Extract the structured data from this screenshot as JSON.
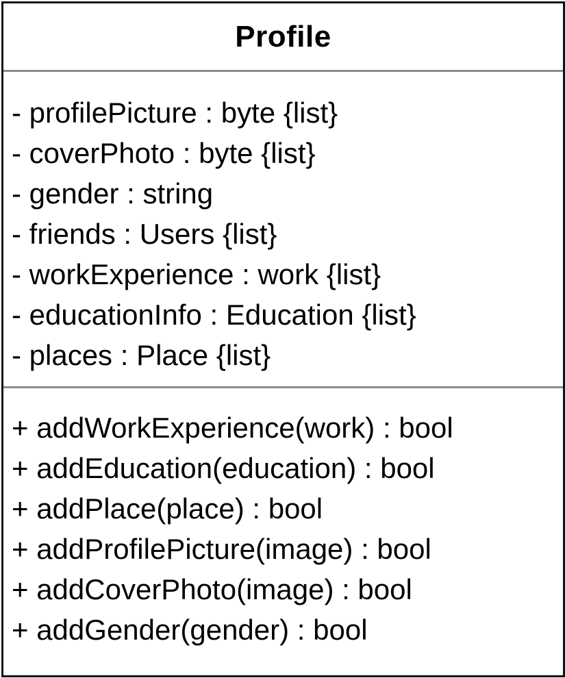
{
  "class_box": {
    "name": "Profile",
    "attributes": [
      "- profilePicture : byte {list}",
      "- coverPhoto : byte {list}",
      "- gender : string",
      "- friends : Users {list}",
      "- workExperience : work {list}",
      "- educationInfo : Education {list}",
      "- places : Place {list}"
    ],
    "operations": [
      "+ addWorkExperience(work) : bool",
      "+ addEducation(education) : bool",
      "+ addPlace(place) : bool",
      "+ addProfilePicture(image) : bool",
      "+ addCoverPhoto(image) : bool",
      "+ addGender(gender) : bool"
    ]
  }
}
